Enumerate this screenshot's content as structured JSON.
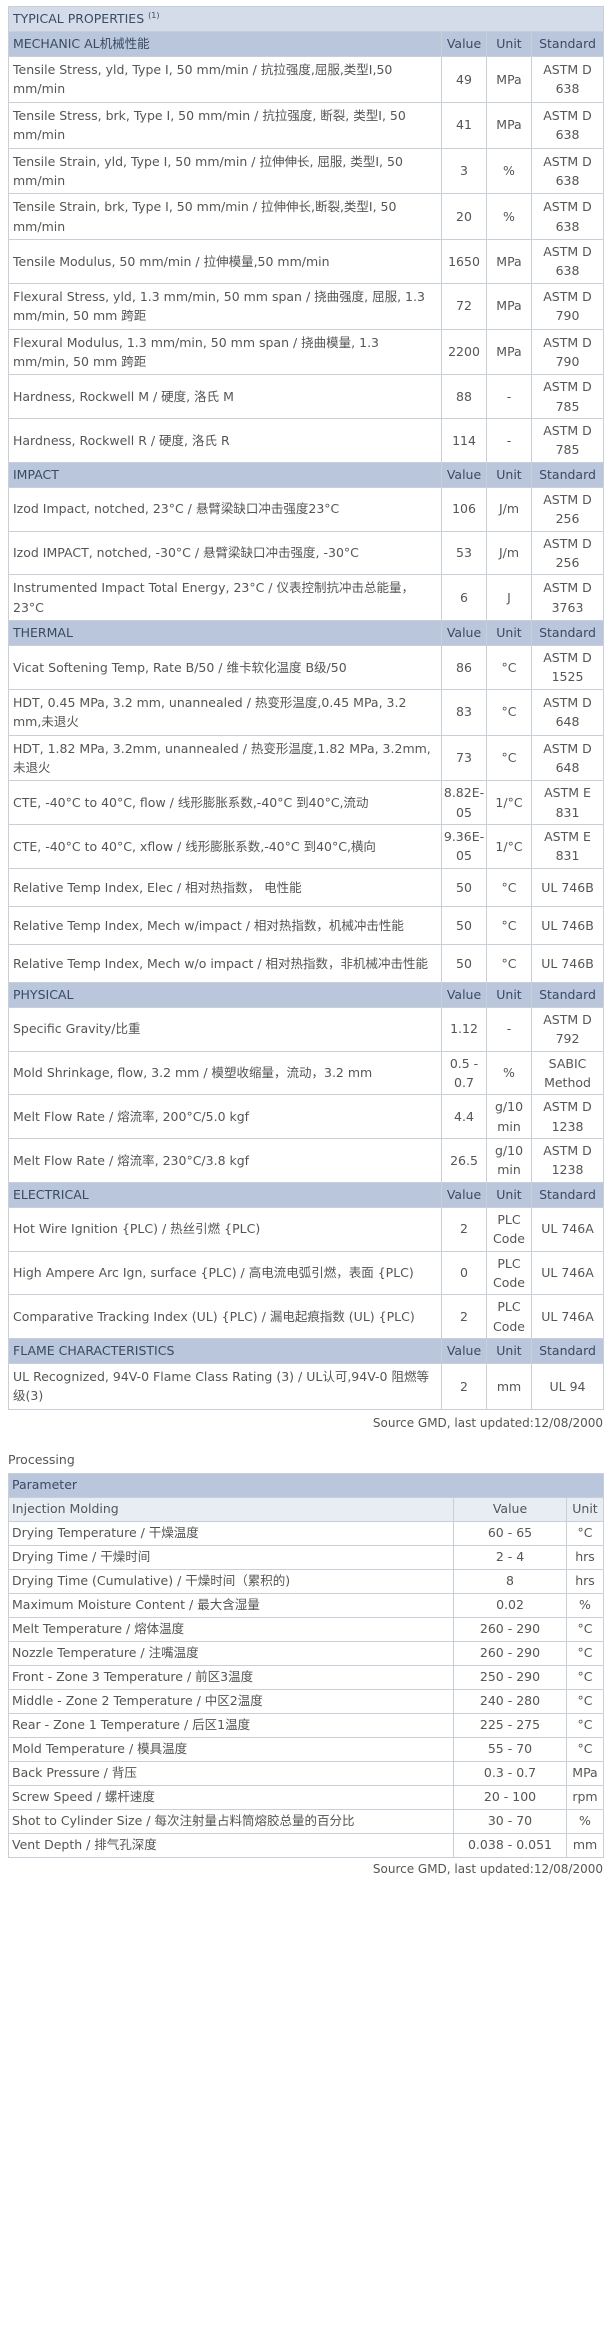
{
  "title": "TYPICAL PROPERTIES",
  "title_note": "(1)",
  "sections": [
    {
      "name": "MECHANIC AL机械性能",
      "cols": [
        "Value",
        "Unit",
        "Standard"
      ],
      "rows": [
        {
          "prop": "Tensile Stress, yld, Type I, 50 mm/min / 抗拉强度,屈服,类型I,50 mm/min",
          "value": "49",
          "unit": "MPa",
          "std": "ASTM D 638"
        },
        {
          "prop": "Tensile Stress, brk, Type I, 50 mm/min / 抗拉强度, 断裂, 类型I, 50 mm/min",
          "value": "41",
          "unit": "MPa",
          "std": "ASTM D 638"
        },
        {
          "prop": "Tensile Strain, yld, Type I, 50 mm/min / 拉伸伸长, 屈服, 类型I, 50 mm/min",
          "value": "3",
          "unit": "%",
          "std": "ASTM D 638"
        },
        {
          "prop": "Tensile Strain, brk, Type I, 50 mm/min / 拉伸伸长,断裂,类型I, 50 mm/min",
          "value": "20",
          "unit": "%",
          "std": "ASTM D 638"
        },
        {
          "prop": "Tensile Modulus, 50 mm/min / 拉伸模量,50 mm/min",
          "value": "1650",
          "unit": "MPa",
          "std": "ASTM D 638"
        },
        {
          "prop": "Flexural Stress, yld, 1.3 mm/min, 50 mm span / 挠曲强度, 屈服, 1.3 mm/min, 50 mm 跨距",
          "value": "72",
          "unit": "MPa",
          "std": "ASTM D 790"
        },
        {
          "prop": "Flexural Modulus, 1.3 mm/min, 50 mm span / 挠曲模量, 1.3 mm/min, 50 mm 跨距",
          "value": "2200",
          "unit": "MPa",
          "std": "ASTM D 790"
        },
        {
          "prop": "Hardness, Rockwell M / 硬度, 洛氏 M",
          "value": "88",
          "unit": "-",
          "std": "ASTM D 785"
        },
        {
          "prop": "Hardness, Rockwell R / 硬度, 洛氏 R",
          "value": "114",
          "unit": "-",
          "std": "ASTM D 785"
        }
      ]
    },
    {
      "name": "IMPACT",
      "cols": [
        "Value",
        "Unit",
        "Standard"
      ],
      "rows": [
        {
          "prop": "Izod Impact, notched, 23°C / 悬臂梁缺口冲击强度23°C",
          "value": "106",
          "unit": "J/m",
          "std": "ASTM D 256"
        },
        {
          "prop": "Izod IMPACT, notched, -30°C / 悬臂梁缺口冲击强度, -30°C",
          "value": "53",
          "unit": "J/m",
          "std": "ASTM D 256"
        },
        {
          "prop": "Instrumented Impact Total Energy, 23°C / 仪表控制抗冲击总能量，23°C",
          "value": "6",
          "unit": "J",
          "std": "ASTM D 3763"
        }
      ]
    },
    {
      "name": "THERMAL",
      "cols": [
        "Value",
        "Unit",
        "Standard"
      ],
      "rows": [
        {
          "prop": "Vicat Softening Temp, Rate B/50 / 维卡软化温度 B级/50",
          "value": "86",
          "unit": "°C",
          "std": "ASTM D 1525"
        },
        {
          "prop": "HDT, 0.45 MPa, 3.2 mm, unannealed / 热变形温度,0.45 MPa, 3.2 mm,未退火",
          "value": "83",
          "unit": "°C",
          "std": "ASTM D 648"
        },
        {
          "prop": "HDT, 1.82 MPa, 3.2mm, unannealed / 热变形温度,1.82 MPa, 3.2mm,未退火",
          "value": "73",
          "unit": "°C",
          "std": "ASTM D 648"
        },
        {
          "prop": "CTE, -40°C to 40°C, flow / 线形膨胀系数,-40°C 到40°C,流动",
          "value": "8.82E-05",
          "unit": "1/°C",
          "std": "ASTM E 831"
        },
        {
          "prop": "CTE, -40°C to 40°C, xflow / 线形膨胀系数,-40°C 到40°C,横向",
          "value": "9.36E-05",
          "unit": "1/°C",
          "std": "ASTM E 831"
        },
        {
          "prop": "Relative Temp Index, Elec / 相对热指数， 电性能",
          "value": "50",
          "unit": "°C",
          "std": "UL 746B"
        },
        {
          "prop": "Relative Temp Index, Mech w/impact / 相对热指数，机械冲击性能",
          "value": "50",
          "unit": "°C",
          "std": "UL 746B"
        },
        {
          "prop": "Relative Temp Index, Mech w/o impact / 相对热指数，非机械冲击性能",
          "value": "50",
          "unit": "°C",
          "std": "UL 746B"
        }
      ]
    },
    {
      "name": "PHYSICAL",
      "cols": [
        "Value",
        "Unit",
        "Standard"
      ],
      "rows": [
        {
          "prop": "Specific Gravity/比重",
          "value": "1.12",
          "unit": "-",
          "std": "ASTM D 792"
        },
        {
          "prop": "Mold Shrinkage, flow, 3.2 mm / 模塑收缩量，流动，3.2 mm",
          "value": "0.5 - 0.7",
          "unit": "%",
          "std": "SABIC Method"
        },
        {
          "prop": "Melt Flow Rate / 熔流率, 200°C/5.0 kgf",
          "value": "4.4",
          "unit": "g/10 min",
          "std": "ASTM D 1238"
        },
        {
          "prop": "Melt Flow Rate / 熔流率, 230°C/3.8 kgf",
          "value": "26.5",
          "unit": "g/10 min",
          "std": "ASTM D 1238"
        }
      ]
    },
    {
      "name": "ELECTRICAL",
      "cols": [
        "Value",
        "Unit",
        "Standard"
      ],
      "rows": [
        {
          "prop": "Hot Wire Ignition {PLC) / 热丝引燃 {PLC)",
          "value": "2",
          "unit": "PLC Code",
          "std": "UL 746A"
        },
        {
          "prop": "High Ampere Arc Ign, surface {PLC) / 高电流电弧引燃，表面 {PLC)",
          "value": "0",
          "unit": "PLC Code",
          "std": "UL 746A"
        },
        {
          "prop": "Comparative Tracking Index (UL) {PLC) / 漏电起痕指数 (UL) {PLC)",
          "value": "2",
          "unit": "PLC Code",
          "std": "UL 746A"
        }
      ]
    },
    {
      "name": "FLAME CHARACTERISTICS",
      "cols": [
        "Value",
        "Unit",
        "Standard"
      ],
      "rows": [
        {
          "prop": "UL Recognized, 94V-0 Flame Class Rating (3) / UL认可,94V-0 阻燃等级(3)",
          "value": "2",
          "unit": "mm",
          "std": "UL 94"
        }
      ]
    }
  ],
  "source_note": "Source GMD, last updated:12/08/2000",
  "processing": {
    "label": "Processing",
    "parameter_header": "Parameter",
    "group": "Injection Molding",
    "cols": [
      "Value",
      "Unit"
    ],
    "rows": [
      {
        "prop": "Drying Temperature / 干燥温度",
        "value": "60 - 65",
        "unit": "°C"
      },
      {
        "prop": "Drying Time / 干燥时间",
        "value": "2 - 4",
        "unit": "hrs"
      },
      {
        "prop": "Drying Time (Cumulative) / 干燥时间（累积的)",
        "value": "8",
        "unit": "hrs"
      },
      {
        "prop": "Maximum Moisture Content / 最大含湿量",
        "value": "0.02",
        "unit": "%"
      },
      {
        "prop": "Melt Temperature / 熔体温度",
        "value": "260 - 290",
        "unit": "°C"
      },
      {
        "prop": "Nozzle Temperature / 注嘴温度",
        "value": "260 - 290",
        "unit": "°C"
      },
      {
        "prop": "Front - Zone 3 Temperature / 前区3温度",
        "value": "250 - 290",
        "unit": "°C"
      },
      {
        "prop": "Middle - Zone 2 Temperature / 中区2温度",
        "value": "240 - 280",
        "unit": "°C"
      },
      {
        "prop": "Rear - Zone 1 Temperature / 后区1温度",
        "value": "225 - 275",
        "unit": "°C"
      },
      {
        "prop": "Mold Temperature / 模具温度",
        "value": "55 - 70",
        "unit": "°C"
      },
      {
        "prop": "Back Pressure / 背压",
        "value": "0.3 - 0.7",
        "unit": "MPa"
      },
      {
        "prop": "Screw Speed / 螺杆速度",
        "value": "20 - 100",
        "unit": "rpm"
      },
      {
        "prop": "Shot to Cylinder Size / 每次注射量占料筒熔胶总量的百分比",
        "value": "30 - 70",
        "unit": "%"
      },
      {
        "prop": "Vent Depth / 排气孔深度",
        "value": "0.038 - 0.051",
        "unit": "mm"
      }
    ],
    "source_note": "Source GMD, last updated:12/08/2000"
  }
}
